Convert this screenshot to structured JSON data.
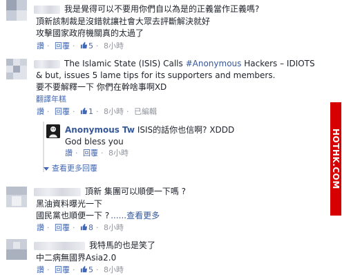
{
  "comments": [
    {
      "lines": [
        "我是覺得可以不要用你們自以為是的正義當作正義嗎?",
        "頂新該制裁是沒錯就讓社會大眾去評斷解決就好",
        "攻擊國家政府機關真的太過了"
      ],
      "actions": {
        "like": "讚",
        "reply": "回覆",
        "likes": "5",
        "time": "8小時"
      }
    },
    {
      "lines_pre": "The Islamic State (ISIS) Calls ",
      "hashtag": "#Anonymous",
      "lines_post": " Hackers – IDIOTS",
      "line2": "& but, issues 5 lame tips for its supporters and members.",
      "line3": "要不要解釋一下 你們在幹啥事啊XD",
      "translate": "翻譯年糕",
      "actions": {
        "like": "讚",
        "reply": "回覆",
        "likes": "1",
        "time": "8小時",
        "edited": "已編輯"
      },
      "reply": {
        "author": "Anonymous Tw",
        "text1": "ISIS的話你也信啊? XDDD",
        "text2": "God bless you",
        "actions": {
          "like": "讚",
          "reply": "回覆",
          "time": "8小時"
        }
      },
      "more_replies": "查看更多回覆"
    },
    {
      "line1": "頂新 集團可以順便一下嗎 ?",
      "line2": "黑油資料曝光一下",
      "line3": "國民黨也順便一下 ?",
      "see_more": "......查看更多",
      "actions": {
        "like": "讚",
        "reply": "回覆",
        "likes": "8",
        "time": "8小時"
      }
    },
    {
      "line1": "我特馬的也是笑了",
      "line2": "中二病無國界Asia2.0",
      "actions": {
        "like": "讚",
        "reply": "回覆",
        "likes": "5",
        "time": "8小時"
      }
    }
  ],
  "watermark": "HOTHK.COM",
  "colors": {
    "link": "#365899",
    "meta": "#90949c",
    "action": "#4267b2",
    "watermark": "#d60000"
  }
}
